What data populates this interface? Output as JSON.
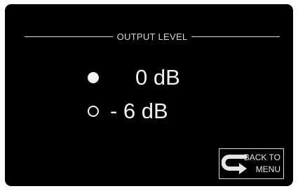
{
  "screen": {
    "title": "OUTPUT LEVEL",
    "options": [
      {
        "label": "0 dB",
        "selected": true
      },
      {
        "label": "- 6 dB",
        "selected": false
      }
    ],
    "back_button": {
      "line1": "BACK TO",
      "line2": "MENU",
      "icon": "return-arrow-icon"
    }
  },
  "colors": {
    "background": "#000000",
    "foreground": "#f2f2f2",
    "line": "#d8d8d8"
  }
}
